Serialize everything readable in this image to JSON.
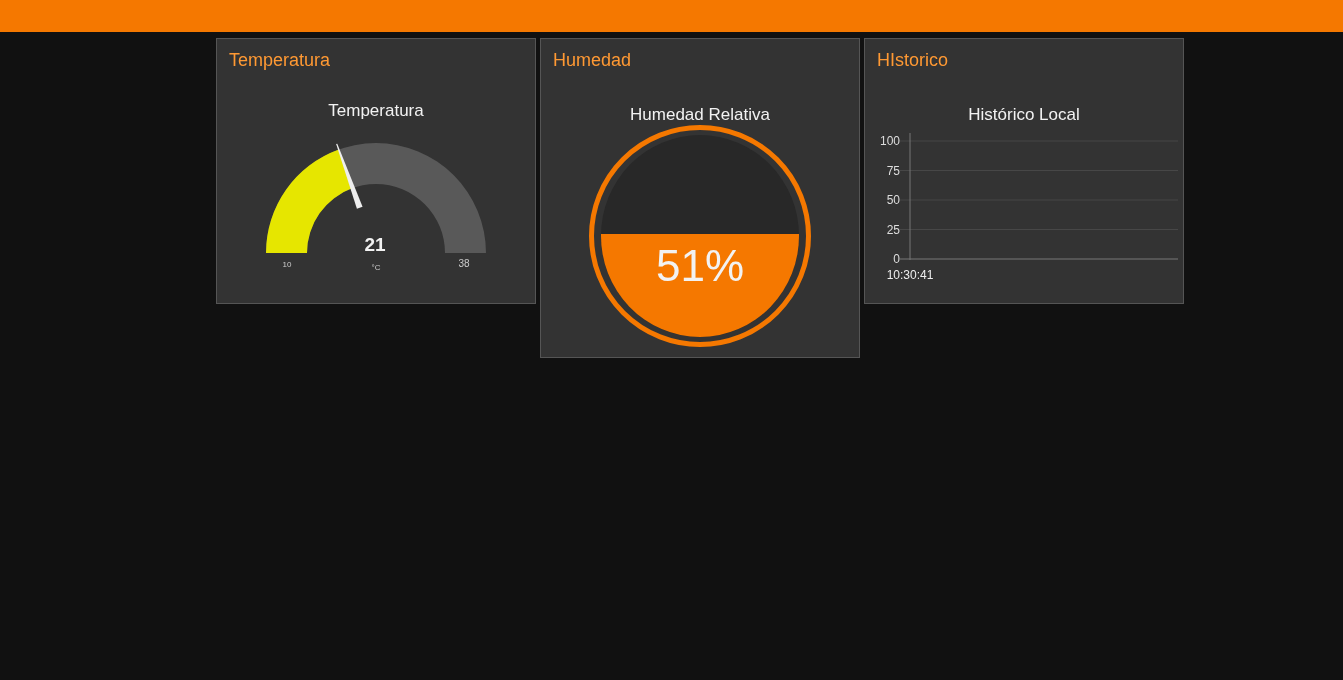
{
  "cards": [
    {
      "kind": "gauge",
      "title": "Temperatura",
      "gauge": {
        "label": "Temperatura",
        "value": "21",
        "units": "°C",
        "min": "10",
        "max": "38",
        "level": 0.39
      }
    },
    {
      "kind": "liquid",
      "title": "Humedad",
      "liquid": {
        "label": "Humedad Relativa",
        "reading": "51%",
        "level": 0.51
      }
    },
    {
      "kind": "chart",
      "title": "HIstorico",
      "chart_data": {
        "type": "line",
        "title": "Histórico Local",
        "categories": [
          "10:30:41"
        ],
        "ylim": [
          0,
          100
        ],
        "yticks": [
          0,
          25,
          50,
          75,
          100
        ],
        "grid": true
      }
    }
  ]
}
